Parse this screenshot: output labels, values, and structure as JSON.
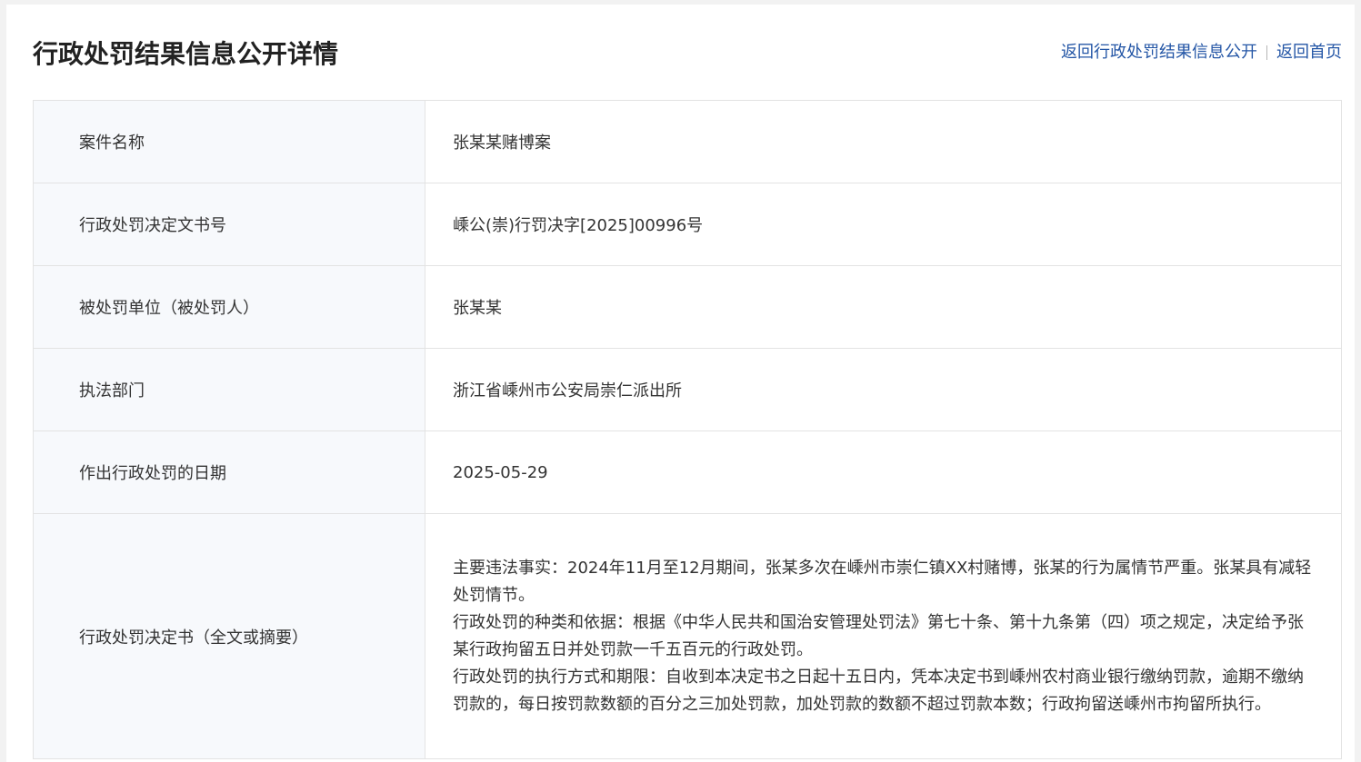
{
  "page_title": "行政处罚结果信息公开详情",
  "nav": {
    "back_to_list": "返回行政处罚结果信息公开",
    "back_home": "返回首页"
  },
  "fields": [
    {
      "label": "案件名称",
      "value": "张某某赌博案"
    },
    {
      "label": "行政处罚决定文书号",
      "value": "嵊公(崇)行罚决字[2025]00996号"
    },
    {
      "label": "被处罚单位（被处罚人）",
      "value": "张某某"
    },
    {
      "label": "执法部门",
      "value": "浙江省嵊州市公安局崇仁派出所"
    },
    {
      "label": "作出行政处罚的日期",
      "value": "2025-05-29"
    }
  ],
  "decision": {
    "label": "行政处罚决定书（全文或摘要）",
    "paragraphs": [
      "主要违法事实：2024年11月至12月期间，张某多次在嵊州市崇仁镇XX村赌博，张某的行为属情节严重。张某具有减轻处罚情节。",
      "行政处罚的种类和依据：根据《中华人民共和国治安管理处罚法》第七十条、第十九条第（四）项之规定，决定给予张某行政拘留五日并处罚款一千五百元的行政处罚。",
      "行政处罚的执行方式和期限：自收到本决定书之日起十五日内，凭本决定书到嵊州农村商业银行缴纳罚款，逾期不缴纳罚款的，每日按罚款数额的百分之三加处罚款，加处罚款的数额不超过罚款本数；行政拘留送嵊州市拘留所执行。"
    ]
  }
}
